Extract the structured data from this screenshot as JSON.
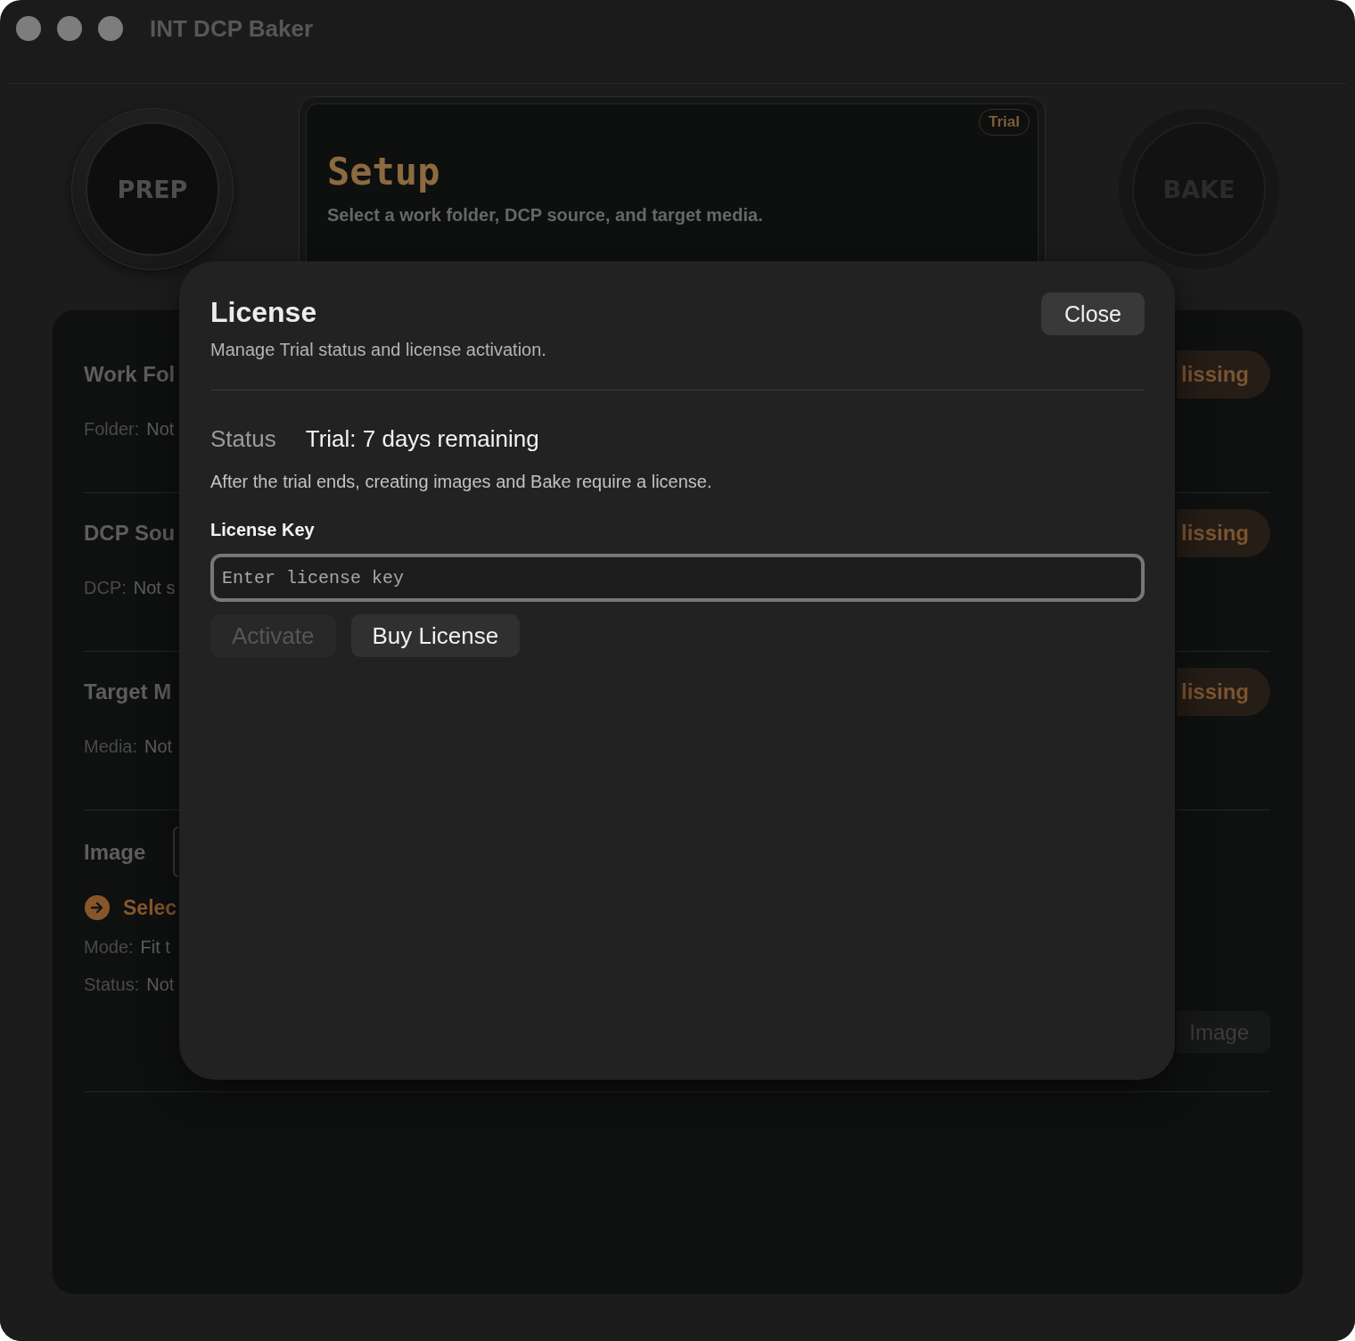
{
  "window": {
    "title": "INT DCP Baker"
  },
  "header": {
    "prep_dial": {
      "label": "PREP",
      "disabled": false
    },
    "stage_card": {
      "badge": "Trial",
      "title": "Setup",
      "subtitle": "Select a work folder, DCP source, and target media."
    },
    "bake_dial": {
      "label": "BAKE",
      "disabled": true
    }
  },
  "sections": [
    {
      "kind": "input",
      "title": "Work Fol",
      "fields": [
        {
          "label": "Folder:",
          "value": "Not"
        }
      ],
      "badge": "lissing"
    },
    {
      "kind": "input",
      "title": "DCP Sou",
      "fields": [
        {
          "label": "DCP:",
          "value": "Not s"
        }
      ],
      "badge": "lissing"
    },
    {
      "kind": "input",
      "title": "Target M",
      "fields": [
        {
          "label": "Media:",
          "value": "Not"
        }
      ],
      "badge": "lissing"
    },
    {
      "kind": "image",
      "title": "Image",
      "action": "Selec",
      "fields": [
        {
          "label": "Mode:",
          "value": "Fit t"
        },
        {
          "label": "Status:",
          "value": "Not"
        }
      ],
      "button": "Image"
    }
  ],
  "license_sheet": {
    "title": "License",
    "subtitle": "Manage Trial status and license activation.",
    "close_button": "Close",
    "status_label": "Status",
    "status_value": "Trial: 7 days remaining",
    "note": "After the trial ends, creating images and Bake require a license.",
    "key_label": "License Key",
    "key_field": {
      "placeholder": "Enter license key"
    },
    "buttons": [
      {
        "label": "Activate",
        "disabled": true
      },
      {
        "label": "Buy License",
        "disabled": false
      }
    ]
  }
}
